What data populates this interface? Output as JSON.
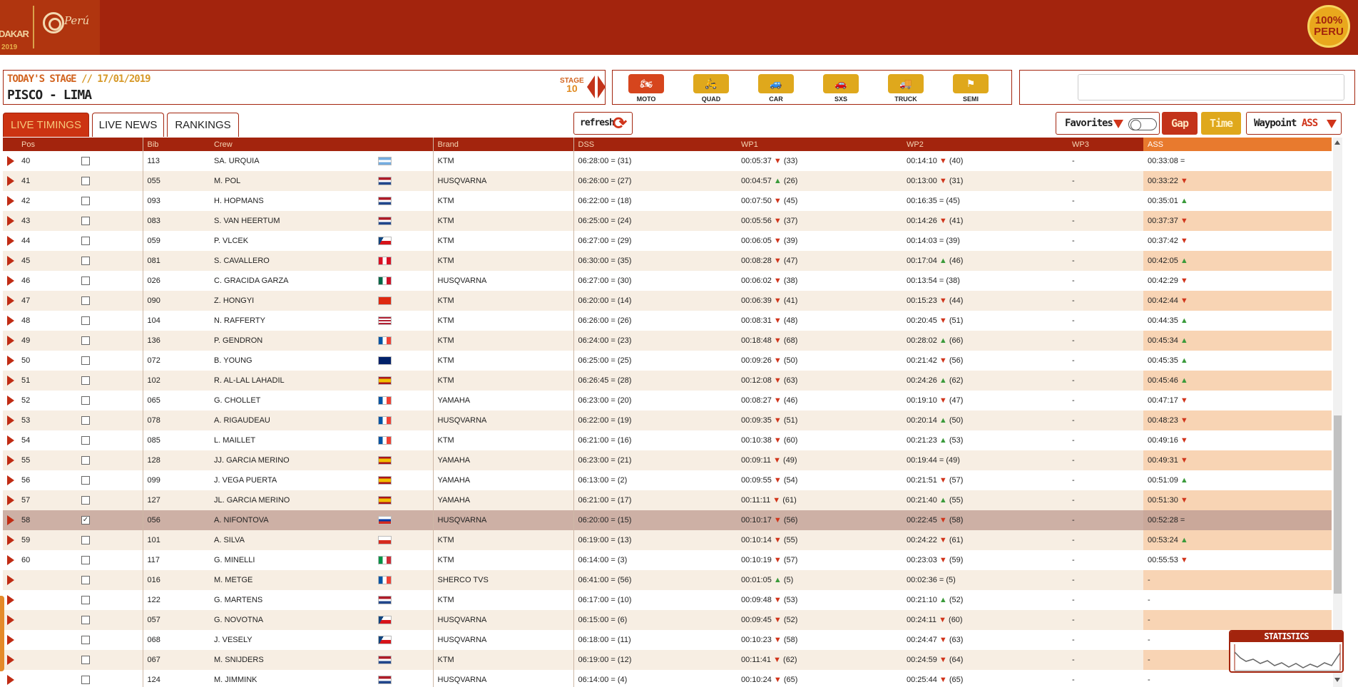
{
  "header": {
    "logo_text": "DAKAR",
    "logo_year": "2019",
    "country": "Perú",
    "badge": "100% PERU"
  },
  "stage": {
    "label": "TODAY'S STAGE",
    "date": "// 17/01/2019",
    "route": "PISCO - LIMA",
    "stage_word": "STAGE",
    "stage_number": "10"
  },
  "categories": [
    {
      "name": "MOTO",
      "icon": "moto-icon",
      "glyph": "🏍",
      "active": true
    },
    {
      "name": "QUAD",
      "icon": "quad-icon",
      "glyph": "🛵",
      "active": false
    },
    {
      "name": "CAR",
      "icon": "car-icon",
      "glyph": "🚙",
      "active": false
    },
    {
      "name": "SXS",
      "icon": "sxs-icon",
      "glyph": "🚗",
      "active": false
    },
    {
      "name": "TRUCK",
      "icon": "truck-icon",
      "glyph": "🚚",
      "active": false
    },
    {
      "name": "SEMI",
      "icon": "semi-icon",
      "glyph": "⚑",
      "active": false
    }
  ],
  "search": {
    "placeholder": "",
    "value": ""
  },
  "tabs": [
    {
      "label": "LIVE TIMINGS",
      "active": true
    },
    {
      "label": "LIVE NEWS",
      "active": false
    },
    {
      "label": "RANKINGS",
      "active": false
    }
  ],
  "controls": {
    "refresh": "refresh",
    "favorites": "Favorites",
    "gap": "Gap",
    "time": "Time",
    "waypoint": "Waypoint",
    "waypoint_value": "ASS"
  },
  "colors": {
    "primary": "#a3240d",
    "accent_orange": "#e87a2e",
    "accent_gold": "#dfa81c",
    "up": "#3a9a3a",
    "down": "#d0341a"
  },
  "table": {
    "columns": [
      "Pos",
      "Bib",
      "Crew",
      "Brand",
      "DSS",
      "WP1",
      "WP2",
      "WP3",
      "ASS"
    ],
    "rows": [
      {
        "pos": "40",
        "checked": false,
        "bib": "113",
        "crew": "SA. URQUIA",
        "flag": "AR",
        "brand": "KTM",
        "dss": "06:28:00",
        "dss_t": "=",
        "dss_r": "(31)",
        "wp1": "00:05:37",
        "wp1_t": "▼",
        "wp1_r": "(33)",
        "wp2": "00:14:10",
        "wp2_t": "▼",
        "wp2_r": "(40)",
        "wp3": "-",
        "ass": "00:33:08",
        "ass_t": "="
      },
      {
        "pos": "41",
        "checked": false,
        "bib": "055",
        "crew": "M. POL",
        "flag": "NL",
        "brand": "HUSQVARNA",
        "dss": "06:26:00",
        "dss_t": "=",
        "dss_r": "(27)",
        "wp1": "00:04:57",
        "wp1_t": "▲",
        "wp1_r": "(26)",
        "wp2": "00:13:00",
        "wp2_t": "▼",
        "wp2_r": "(31)",
        "wp3": "-",
        "ass": "00:33:22",
        "ass_t": "▼"
      },
      {
        "pos": "42",
        "checked": false,
        "bib": "093",
        "crew": "H. HOPMANS",
        "flag": "NL",
        "brand": "KTM",
        "dss": "06:22:00",
        "dss_t": "=",
        "dss_r": "(18)",
        "wp1": "00:07:50",
        "wp1_t": "▼",
        "wp1_r": "(45)",
        "wp2": "00:16:35",
        "wp2_t": "=",
        "wp2_r": "(45)",
        "wp3": "-",
        "ass": "00:35:01",
        "ass_t": "▲"
      },
      {
        "pos": "43",
        "checked": false,
        "bib": "083",
        "crew": "S. VAN HEERTUM",
        "flag": "NL",
        "brand": "KTM",
        "dss": "06:25:00",
        "dss_t": "=",
        "dss_r": "(24)",
        "wp1": "00:05:56",
        "wp1_t": "▼",
        "wp1_r": "(37)",
        "wp2": "00:14:26",
        "wp2_t": "▼",
        "wp2_r": "(41)",
        "wp3": "-",
        "ass": "00:37:37",
        "ass_t": "▼"
      },
      {
        "pos": "44",
        "checked": false,
        "bib": "059",
        "crew": "P. VLCEK",
        "flag": "CZ",
        "brand": "KTM",
        "dss": "06:27:00",
        "dss_t": "=",
        "dss_r": "(29)",
        "wp1": "00:06:05",
        "wp1_t": "▼",
        "wp1_r": "(39)",
        "wp2": "00:14:03",
        "wp2_t": "=",
        "wp2_r": "(39)",
        "wp3": "-",
        "ass": "00:37:42",
        "ass_t": "▼"
      },
      {
        "pos": "45",
        "checked": false,
        "bib": "081",
        "crew": "S. CAVALLERO",
        "flag": "PE",
        "brand": "KTM",
        "dss": "06:30:00",
        "dss_t": "=",
        "dss_r": "(35)",
        "wp1": "00:08:28",
        "wp1_t": "▼",
        "wp1_r": "(47)",
        "wp2": "00:17:04",
        "wp2_t": "▲",
        "wp2_r": "(46)",
        "wp3": "-",
        "ass": "00:42:05",
        "ass_t": "▲"
      },
      {
        "pos": "46",
        "checked": false,
        "bib": "026",
        "crew": "C. GRACIDA GARZA",
        "flag": "MX",
        "brand": "HUSQVARNA",
        "dss": "06:27:00",
        "dss_t": "=",
        "dss_r": "(30)",
        "wp1": "00:06:02",
        "wp1_t": "▼",
        "wp1_r": "(38)",
        "wp2": "00:13:54",
        "wp2_t": "=",
        "wp2_r": "(38)",
        "wp3": "-",
        "ass": "00:42:29",
        "ass_t": "▼"
      },
      {
        "pos": "47",
        "checked": false,
        "bib": "090",
        "crew": "Z. HONGYI",
        "flag": "CN",
        "brand": "KTM",
        "dss": "06:20:00",
        "dss_t": "=",
        "dss_r": "(14)",
        "wp1": "00:06:39",
        "wp1_t": "▼",
        "wp1_r": "(41)",
        "wp2": "00:15:23",
        "wp2_t": "▼",
        "wp2_r": "(44)",
        "wp3": "-",
        "ass": "00:42:44",
        "ass_t": "▼"
      },
      {
        "pos": "48",
        "checked": false,
        "bib": "104",
        "crew": "N. RAFFERTY",
        "flag": "US",
        "brand": "KTM",
        "dss": "06:26:00",
        "dss_t": "=",
        "dss_r": "(26)",
        "wp1": "00:08:31",
        "wp1_t": "▼",
        "wp1_r": "(48)",
        "wp2": "00:20:45",
        "wp2_t": "▼",
        "wp2_r": "(51)",
        "wp3": "-",
        "ass": "00:44:35",
        "ass_t": "▲"
      },
      {
        "pos": "49",
        "checked": false,
        "bib": "136",
        "crew": "P. GENDRON",
        "flag": "FR",
        "brand": "KTM",
        "dss": "06:24:00",
        "dss_t": "=",
        "dss_r": "(23)",
        "wp1": "00:18:48",
        "wp1_t": "▼",
        "wp1_r": "(68)",
        "wp2": "00:28:02",
        "wp2_t": "▲",
        "wp2_r": "(66)",
        "wp3": "-",
        "ass": "00:45:34",
        "ass_t": "▲"
      },
      {
        "pos": "50",
        "checked": false,
        "bib": "072",
        "crew": "B. YOUNG",
        "flag": "AU",
        "brand": "KTM",
        "dss": "06:25:00",
        "dss_t": "=",
        "dss_r": "(25)",
        "wp1": "00:09:26",
        "wp1_t": "▼",
        "wp1_r": "(50)",
        "wp2": "00:21:42",
        "wp2_t": "▼",
        "wp2_r": "(56)",
        "wp3": "-",
        "ass": "00:45:35",
        "ass_t": "▲"
      },
      {
        "pos": "51",
        "checked": false,
        "bib": "102",
        "crew": "R. AL-LAL LAHADIL",
        "flag": "ES",
        "brand": "KTM",
        "dss": "06:26:45",
        "dss_t": "=",
        "dss_r": "(28)",
        "wp1": "00:12:08",
        "wp1_t": "▼",
        "wp1_r": "(63)",
        "wp2": "00:24:26",
        "wp2_t": "▲",
        "wp2_r": "(62)",
        "wp3": "-",
        "ass": "00:45:46",
        "ass_t": "▲"
      },
      {
        "pos": "52",
        "checked": false,
        "bib": "065",
        "crew": "G. CHOLLET",
        "flag": "FR",
        "brand": "YAMAHA",
        "dss": "06:23:00",
        "dss_t": "=",
        "dss_r": "(20)",
        "wp1": "00:08:27",
        "wp1_t": "▼",
        "wp1_r": "(46)",
        "wp2": "00:19:10",
        "wp2_t": "▼",
        "wp2_r": "(47)",
        "wp3": "-",
        "ass": "00:47:17",
        "ass_t": "▼"
      },
      {
        "pos": "53",
        "checked": false,
        "bib": "078",
        "crew": "A. RIGAUDEAU",
        "flag": "FR",
        "brand": "HUSQVARNA",
        "dss": "06:22:00",
        "dss_t": "=",
        "dss_r": "(19)",
        "wp1": "00:09:35",
        "wp1_t": "▼",
        "wp1_r": "(51)",
        "wp2": "00:20:14",
        "wp2_t": "▲",
        "wp2_r": "(50)",
        "wp3": "-",
        "ass": "00:48:23",
        "ass_t": "▼"
      },
      {
        "pos": "54",
        "checked": false,
        "bib": "085",
        "crew": "L. MAILLET",
        "flag": "FR",
        "brand": "KTM",
        "dss": "06:21:00",
        "dss_t": "=",
        "dss_r": "(16)",
        "wp1": "00:10:38",
        "wp1_t": "▼",
        "wp1_r": "(60)",
        "wp2": "00:21:23",
        "wp2_t": "▲",
        "wp2_r": "(53)",
        "wp3": "-",
        "ass": "00:49:16",
        "ass_t": "▼"
      },
      {
        "pos": "55",
        "checked": false,
        "bib": "128",
        "crew": "JJ. GARCIA MERINO",
        "flag": "ES",
        "brand": "YAMAHA",
        "dss": "06:23:00",
        "dss_t": "=",
        "dss_r": "(21)",
        "wp1": "00:09:11",
        "wp1_t": "▼",
        "wp1_r": "(49)",
        "wp2": "00:19:44",
        "wp2_t": "=",
        "wp2_r": "(49)",
        "wp3": "-",
        "ass": "00:49:31",
        "ass_t": "▼"
      },
      {
        "pos": "56",
        "checked": false,
        "bib": "099",
        "crew": "J. VEGA PUERTA",
        "flag": "ES",
        "brand": "YAMAHA",
        "dss": "06:13:00",
        "dss_t": "=",
        "dss_r": "(2)",
        "wp1": "00:09:55",
        "wp1_t": "▼",
        "wp1_r": "(54)",
        "wp2": "00:21:51",
        "wp2_t": "▼",
        "wp2_r": "(57)",
        "wp3": "-",
        "ass": "00:51:09",
        "ass_t": "▲"
      },
      {
        "pos": "57",
        "checked": false,
        "bib": "127",
        "crew": "JL. GARCIA MERINO",
        "flag": "ES",
        "brand": "YAMAHA",
        "dss": "06:21:00",
        "dss_t": "=",
        "dss_r": "(17)",
        "wp1": "00:11:11",
        "wp1_t": "▼",
        "wp1_r": "(61)",
        "wp2": "00:21:40",
        "wp2_t": "▲",
        "wp2_r": "(55)",
        "wp3": "-",
        "ass": "00:51:30",
        "ass_t": "▼"
      },
      {
        "pos": "58",
        "checked": true,
        "bib": "056",
        "crew": "A. NIFONTOVA",
        "flag": "RU",
        "brand": "HUSQVARNA",
        "dss": "06:20:00",
        "dss_t": "=",
        "dss_r": "(15)",
        "wp1": "00:10:17",
        "wp1_t": "▼",
        "wp1_r": "(56)",
        "wp2": "00:22:45",
        "wp2_t": "▼",
        "wp2_r": "(58)",
        "wp3": "-",
        "ass": "00:52:28",
        "ass_t": "="
      },
      {
        "pos": "59",
        "checked": false,
        "bib": "101",
        "crew": "A. SILVA",
        "flag": "CL",
        "brand": "KTM",
        "dss": "06:19:00",
        "dss_t": "=",
        "dss_r": "(13)",
        "wp1": "00:10:14",
        "wp1_t": "▼",
        "wp1_r": "(55)",
        "wp2": "00:24:22",
        "wp2_t": "▼",
        "wp2_r": "(61)",
        "wp3": "-",
        "ass": "00:53:24",
        "ass_t": "▲"
      },
      {
        "pos": "60",
        "checked": false,
        "bib": "117",
        "crew": "G. MINELLI",
        "flag": "IT",
        "brand": "KTM",
        "dss": "06:14:00",
        "dss_t": "=",
        "dss_r": "(3)",
        "wp1": "00:10:19",
        "wp1_t": "▼",
        "wp1_r": "(57)",
        "wp2": "00:23:03",
        "wp2_t": "▼",
        "wp2_r": "(59)",
        "wp3": "-",
        "ass": "00:55:53",
        "ass_t": "▼"
      },
      {
        "pos": "",
        "checked": false,
        "bib": "016",
        "crew": "M. METGE",
        "flag": "FR",
        "brand": "SHERCO TVS",
        "dss": "06:41:00",
        "dss_t": "=",
        "dss_r": "(56)",
        "wp1": "00:01:05",
        "wp1_t": "▲",
        "wp1_r": "(5)",
        "wp2": "00:02:36",
        "wp2_t": "=",
        "wp2_r": "(5)",
        "wp3": "-",
        "ass": "-",
        "ass_t": ""
      },
      {
        "pos": "",
        "checked": false,
        "bib": "122",
        "crew": "G. MARTENS",
        "flag": "NL",
        "brand": "KTM",
        "dss": "06:17:00",
        "dss_t": "=",
        "dss_r": "(10)",
        "wp1": "00:09:48",
        "wp1_t": "▼",
        "wp1_r": "(53)",
        "wp2": "00:21:10",
        "wp2_t": "▲",
        "wp2_r": "(52)",
        "wp3": "-",
        "ass": "-",
        "ass_t": ""
      },
      {
        "pos": "",
        "checked": false,
        "bib": "057",
        "crew": "G. NOVOTNA",
        "flag": "CZ",
        "brand": "HUSQVARNA",
        "dss": "06:15:00",
        "dss_t": "=",
        "dss_r": "(6)",
        "wp1": "00:09:45",
        "wp1_t": "▼",
        "wp1_r": "(52)",
        "wp2": "00:24:11",
        "wp2_t": "▼",
        "wp2_r": "(60)",
        "wp3": "-",
        "ass": "-",
        "ass_t": ""
      },
      {
        "pos": "",
        "checked": false,
        "bib": "068",
        "crew": "J. VESELY",
        "flag": "CZ",
        "brand": "HUSQVARNA",
        "dss": "06:18:00",
        "dss_t": "=",
        "dss_r": "(11)",
        "wp1": "00:10:23",
        "wp1_t": "▼",
        "wp1_r": "(58)",
        "wp2": "00:24:47",
        "wp2_t": "▼",
        "wp2_r": "(63)",
        "wp3": "-",
        "ass": "-",
        "ass_t": ""
      },
      {
        "pos": "",
        "checked": false,
        "bib": "067",
        "crew": "M. SNIJDERS",
        "flag": "NL",
        "brand": "KTM",
        "dss": "06:19:00",
        "dss_t": "=",
        "dss_r": "(12)",
        "wp1": "00:11:41",
        "wp1_t": "▼",
        "wp1_r": "(62)",
        "wp2": "00:24:59",
        "wp2_t": "▼",
        "wp2_r": "(64)",
        "wp3": "-",
        "ass": "-",
        "ass_t": ""
      },
      {
        "pos": "",
        "checked": false,
        "bib": "124",
        "crew": "M. JIMMINK",
        "flag": "NL",
        "brand": "HUSQVARNA",
        "dss": "06:14:00",
        "dss_t": "=",
        "dss_r": "(4)",
        "wp1": "00:10:24",
        "wp1_t": "▼",
        "wp1_r": "(65)",
        "wp2": "00:25:44",
        "wp2_t": "▼",
        "wp2_r": "(65)",
        "wp3": "-",
        "ass": "-",
        "ass_t": ""
      }
    ]
  },
  "statistics": {
    "title": "STATISTICS"
  }
}
